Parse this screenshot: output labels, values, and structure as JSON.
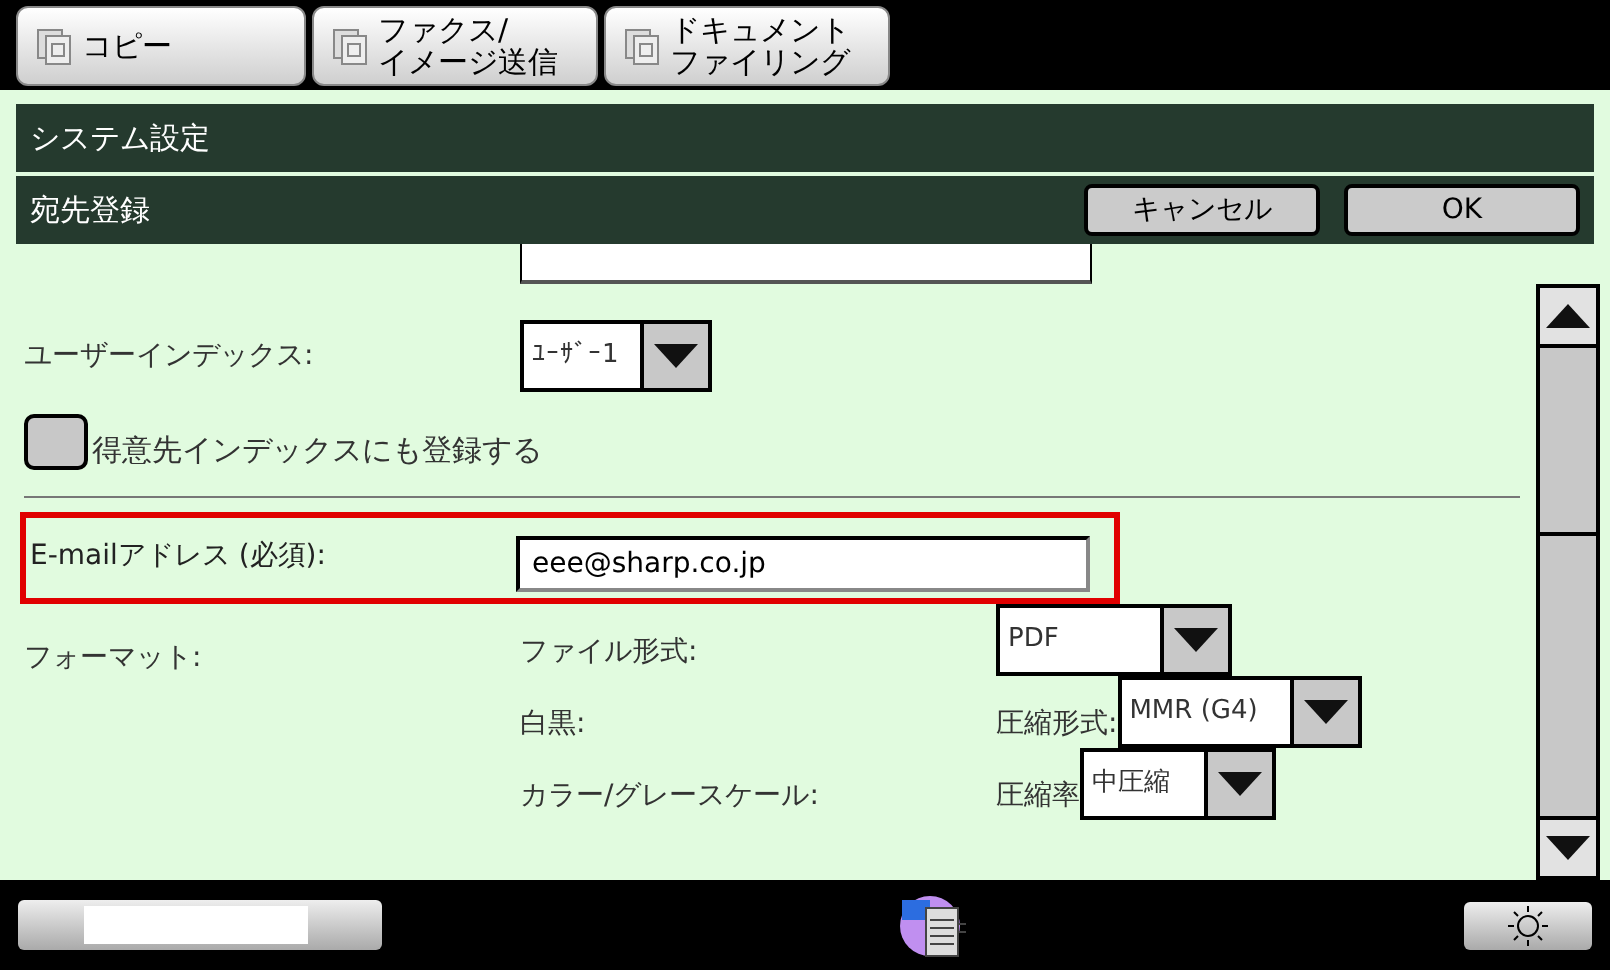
{
  "tabs": [
    {
      "lines": [
        "コピー"
      ]
    },
    {
      "lines": [
        "ファクス/",
        "イメージ送信"
      ]
    },
    {
      "lines": [
        "ドキュメント",
        "ファイリング"
      ]
    }
  ],
  "header": {
    "title": "システム設定"
  },
  "subheader": {
    "title": "宛先登録",
    "buttons": [
      "キャンセル",
      "OK"
    ]
  },
  "user_index": {
    "label": "ユーザーインデックス:",
    "value": "ﾕｰｻﾞｰ1"
  },
  "checkbox": {
    "label": "得意先インデックスにも登録する",
    "checked": false
  },
  "email": {
    "label": "E-mailアドレス (必須):",
    "value": "eee@sharp.co.jp",
    "highlighted": true
  },
  "format": {
    "label": "フォーマット:",
    "rows": [
      {
        "label": "ファイル形式:",
        "select": "PDF"
      },
      {
        "label": "白黒:",
        "sublabel": "圧縮形式:",
        "select": "MMR (G4)"
      },
      {
        "label": "カラー/グレースケール:",
        "sublabel": "圧縮率",
        "select": "中圧縮"
      }
    ]
  }
}
